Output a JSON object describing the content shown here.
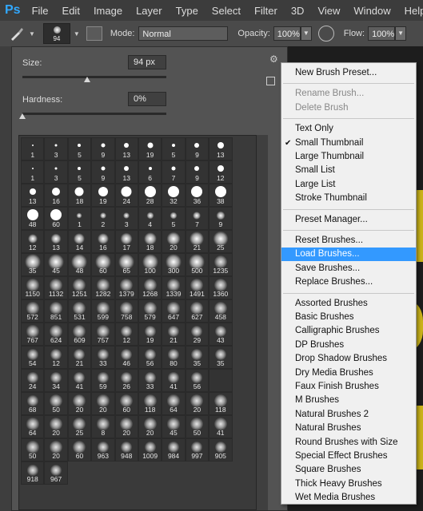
{
  "app": {
    "logo": "Ps"
  },
  "menubar": [
    "File",
    "Edit",
    "Image",
    "Layer",
    "Type",
    "Select",
    "Filter",
    "3D",
    "View",
    "Window",
    "Help"
  ],
  "options": {
    "brush_size_preview": "94",
    "mode_label": "Mode:",
    "mode_value": "Normal",
    "opacity_label": "Opacity:",
    "opacity_value": "100%",
    "flow_label": "Flow:",
    "flow_value": "100%"
  },
  "panel": {
    "size_label": "Size:",
    "size_value": "94 px",
    "hardness_label": "Hardness:",
    "hardness_value": "0%",
    "size_level": 0.45,
    "hardness_level": 0.0
  },
  "brushes": [
    {
      "s": "1",
      "k": "hard",
      "r": 1
    },
    {
      "s": "3",
      "k": "hard",
      "r": 1.5
    },
    {
      "s": "5",
      "k": "hard",
      "r": 2
    },
    {
      "s": "9",
      "k": "hard",
      "r": 2.5
    },
    {
      "s": "13",
      "k": "hard",
      "r": 3
    },
    {
      "s": "19",
      "k": "hard",
      "r": 3.5
    },
    {
      "s": "5",
      "k": "hard",
      "r": 2
    },
    {
      "s": "9",
      "k": "hard",
      "r": 3
    },
    {
      "s": "13",
      "k": "hard",
      "r": 4
    },
    {
      "s": "1",
      "k": "hard",
      "r": 1
    },
    {
      "s": "3",
      "k": "hard",
      "r": 1.5
    },
    {
      "s": "5",
      "k": "hard",
      "r": 2
    },
    {
      "s": "9",
      "k": "hard",
      "r": 2.5
    },
    {
      "s": "13",
      "k": "hard",
      "r": 3
    },
    {
      "s": "6",
      "k": "hard",
      "r": 2
    },
    {
      "s": "7",
      "k": "hard",
      "r": 2.5
    },
    {
      "s": "9",
      "k": "hard",
      "r": 3
    },
    {
      "s": "12",
      "k": "hard",
      "r": 4
    },
    {
      "s": "13",
      "k": "hard",
      "r": 4
    },
    {
      "s": "16",
      "k": "hard",
      "r": 5
    },
    {
      "s": "18",
      "k": "hard",
      "r": 5.5
    },
    {
      "s": "19",
      "k": "hard",
      "r": 6
    },
    {
      "s": "24",
      "k": "hard",
      "r": 6.5
    },
    {
      "s": "28",
      "k": "hard",
      "r": 7
    },
    {
      "s": "32",
      "k": "hard",
      "r": 7
    },
    {
      "s": "36",
      "k": "hard",
      "r": 7
    },
    {
      "s": "38",
      "k": "hard",
      "r": 7
    },
    {
      "s": "48",
      "k": "hard",
      "r": 7
    },
    {
      "s": "60",
      "k": "hard",
      "r": 7
    },
    {
      "s": "1",
      "k": "soft",
      "r": 1.5
    },
    {
      "s": "2",
      "k": "soft",
      "r": 2
    },
    {
      "s": "3",
      "k": "soft",
      "r": 2
    },
    {
      "s": "4",
      "k": "soft",
      "r": 2.5
    },
    {
      "s": "5",
      "k": "soft",
      "r": 2.5
    },
    {
      "s": "7",
      "k": "soft",
      "r": 3
    },
    {
      "s": "9",
      "k": "soft",
      "r": 3.5
    },
    {
      "s": "12",
      "k": "soft",
      "r": 4
    },
    {
      "s": "13",
      "k": "soft",
      "r": 4.5
    },
    {
      "s": "14",
      "k": "soft",
      "r": 5
    },
    {
      "s": "16",
      "k": "soft",
      "r": 5
    },
    {
      "s": "17",
      "k": "soft",
      "r": 5.5
    },
    {
      "s": "18",
      "k": "soft",
      "r": 6
    },
    {
      "s": "20",
      "k": "soft",
      "r": 6.5
    },
    {
      "s": "21",
      "k": "soft",
      "r": 7
    },
    {
      "s": "25",
      "k": "soft",
      "r": 7.5
    },
    {
      "s": "35",
      "k": "soft",
      "r": 8
    },
    {
      "s": "45",
      "k": "soft",
      "r": 8
    },
    {
      "s": "48",
      "k": "soft",
      "r": 8
    },
    {
      "s": "60",
      "k": "soft",
      "r": 8
    },
    {
      "s": "65",
      "k": "soft",
      "r": 8
    },
    {
      "s": "100",
      "k": "soft",
      "r": 8
    },
    {
      "s": "300",
      "k": "soft",
      "r": 8
    },
    {
      "s": "500",
      "k": "soft",
      "r": 8
    },
    {
      "s": "1235",
      "k": "tex",
      "r": 7
    },
    {
      "s": "1150",
      "k": "tex",
      "r": 7
    },
    {
      "s": "1132",
      "k": "tex",
      "r": 7
    },
    {
      "s": "1251",
      "k": "tex",
      "r": 7
    },
    {
      "s": "1282",
      "k": "tex",
      "r": 7
    },
    {
      "s": "1379",
      "k": "tex",
      "r": 7
    },
    {
      "s": "1268",
      "k": "tex",
      "r": 7
    },
    {
      "s": "1339",
      "k": "tex",
      "r": 7
    },
    {
      "s": "1491",
      "k": "tex",
      "r": 7
    },
    {
      "s": "1360",
      "k": "tex",
      "r": 7
    },
    {
      "s": "572",
      "k": "tex",
      "r": 7
    },
    {
      "s": "851",
      "k": "tex",
      "r": 7
    },
    {
      "s": "531",
      "k": "tex",
      "r": 7
    },
    {
      "s": "599",
      "k": "tex",
      "r": 7
    },
    {
      "s": "758",
      "k": "tex",
      "r": 7
    },
    {
      "s": "579",
      "k": "tex",
      "r": 7
    },
    {
      "s": "647",
      "k": "tex",
      "r": 7
    },
    {
      "s": "627",
      "k": "tex",
      "r": 7
    },
    {
      "s": "458",
      "k": "tex",
      "r": 7
    },
    {
      "s": "767",
      "k": "tex",
      "r": 7
    },
    {
      "s": "624",
      "k": "tex",
      "r": 7
    },
    {
      "s": "609",
      "k": "tex",
      "r": 7
    },
    {
      "s": "757",
      "k": "tex",
      "r": 7
    },
    {
      "s": "12",
      "k": "tex",
      "r": 6
    },
    {
      "s": "19",
      "k": "tex",
      "r": 6
    },
    {
      "s": "21",
      "k": "tex",
      "r": 6
    },
    {
      "s": "29",
      "k": "tex",
      "r": 6
    },
    {
      "s": "43",
      "k": "tex",
      "r": 6
    },
    {
      "s": "54",
      "k": "tex",
      "r": 6
    },
    {
      "s": "12",
      "k": "tex",
      "r": 6
    },
    {
      "s": "21",
      "k": "tex",
      "r": 6
    },
    {
      "s": "33",
      "k": "tex",
      "r": 6
    },
    {
      "s": "46",
      "k": "tex",
      "r": 6
    },
    {
      "s": "56",
      "k": "tex",
      "r": 6
    },
    {
      "s": "80",
      "k": "tex",
      "r": 6
    },
    {
      "s": "35",
      "k": "tex",
      "r": 6
    },
    {
      "s": "35",
      "k": "tex",
      "r": 6
    },
    {
      "s": "24",
      "k": "tex",
      "r": 6
    },
    {
      "s": "34",
      "k": "tex",
      "r": 6
    },
    {
      "s": "41",
      "k": "tex",
      "r": 6
    },
    {
      "s": "59",
      "k": "tex",
      "r": 6
    },
    {
      "s": "26",
      "k": "tex",
      "r": 6
    },
    {
      "s": "33",
      "k": "tex",
      "r": 6
    },
    {
      "s": "41",
      "k": "tex",
      "r": 6
    },
    {
      "s": "56",
      "k": "tex",
      "r": 6
    },
    {
      "s": "",
      "k": "empty",
      "r": 0
    },
    {
      "s": "68",
      "k": "tex",
      "r": 6
    },
    {
      "s": "50",
      "k": "tex",
      "r": 7
    },
    {
      "s": "20",
      "k": "tex",
      "r": 7
    },
    {
      "s": "20",
      "k": "tex",
      "r": 7
    },
    {
      "s": "60",
      "k": "tex",
      "r": 7
    },
    {
      "s": "118",
      "k": "tex",
      "r": 7
    },
    {
      "s": "64",
      "k": "tex",
      "r": 7
    },
    {
      "s": "20",
      "k": "tex",
      "r": 7
    },
    {
      "s": "118",
      "k": "tex",
      "r": 7
    },
    {
      "s": "64",
      "k": "tex",
      "r": 7
    },
    {
      "s": "20",
      "k": "tex",
      "r": 7
    },
    {
      "s": "25",
      "k": "tex",
      "r": 7
    },
    {
      "s": "8",
      "k": "tex",
      "r": 7
    },
    {
      "s": "20",
      "k": "tex",
      "r": 7
    },
    {
      "s": "20",
      "k": "tex",
      "r": 7
    },
    {
      "s": "45",
      "k": "tex",
      "r": 7
    },
    {
      "s": "50",
      "k": "tex",
      "r": 7
    },
    {
      "s": "41",
      "k": "tex",
      "r": 7
    },
    {
      "s": "50",
      "k": "tex",
      "r": 7
    },
    {
      "s": "20",
      "k": "tex",
      "r": 7
    },
    {
      "s": "60",
      "k": "tex",
      "r": 7
    },
    {
      "s": "963",
      "k": "tex",
      "r": 6
    },
    {
      "s": "948",
      "k": "tex",
      "r": 6
    },
    {
      "s": "1009",
      "k": "tex",
      "r": 6
    },
    {
      "s": "984",
      "k": "tex",
      "r": 6
    },
    {
      "s": "997",
      "k": "tex",
      "r": 6
    },
    {
      "s": "905",
      "k": "tex",
      "r": 6
    },
    {
      "s": "918",
      "k": "tex",
      "r": 6
    },
    {
      "s": "967",
      "k": "tex",
      "r": 6
    }
  ],
  "dropdown": [
    {
      "label": "New Brush Preset...",
      "state": "normal"
    },
    {
      "sep": true
    },
    {
      "label": "Rename Brush...",
      "state": "disabled"
    },
    {
      "label": "Delete Brush",
      "state": "disabled"
    },
    {
      "sep": true
    },
    {
      "label": "Text Only",
      "state": "normal"
    },
    {
      "label": "Small Thumbnail",
      "state": "checked"
    },
    {
      "label": "Large Thumbnail",
      "state": "normal"
    },
    {
      "label": "Small List",
      "state": "normal"
    },
    {
      "label": "Large List",
      "state": "normal"
    },
    {
      "label": "Stroke Thumbnail",
      "state": "normal"
    },
    {
      "sep": true
    },
    {
      "label": "Preset Manager...",
      "state": "normal"
    },
    {
      "sep": true
    },
    {
      "label": "Reset Brushes...",
      "state": "normal"
    },
    {
      "label": "Load Brushes...",
      "state": "highlighted"
    },
    {
      "label": "Save Brushes...",
      "state": "normal"
    },
    {
      "label": "Replace Brushes...",
      "state": "normal"
    },
    {
      "sep": true
    },
    {
      "label": "Assorted Brushes",
      "state": "normal"
    },
    {
      "label": "Basic Brushes",
      "state": "normal"
    },
    {
      "label": "Calligraphic Brushes",
      "state": "normal"
    },
    {
      "label": "DP Brushes",
      "state": "normal"
    },
    {
      "label": "Drop Shadow Brushes",
      "state": "normal"
    },
    {
      "label": "Dry Media Brushes",
      "state": "normal"
    },
    {
      "label": "Faux Finish Brushes",
      "state": "normal"
    },
    {
      "label": "M Brushes",
      "state": "normal"
    },
    {
      "label": "Natural Brushes 2",
      "state": "normal"
    },
    {
      "label": "Natural Brushes",
      "state": "normal"
    },
    {
      "label": "Round Brushes with Size",
      "state": "normal"
    },
    {
      "label": "Special Effect Brushes",
      "state": "normal"
    },
    {
      "label": "Square Brushes",
      "state": "normal"
    },
    {
      "label": "Thick Heavy Brushes",
      "state": "normal"
    },
    {
      "label": "Wet Media Brushes",
      "state": "normal"
    }
  ],
  "colors": {
    "highlight": "#3399ff",
    "ps_blue": "#31a8ff"
  }
}
